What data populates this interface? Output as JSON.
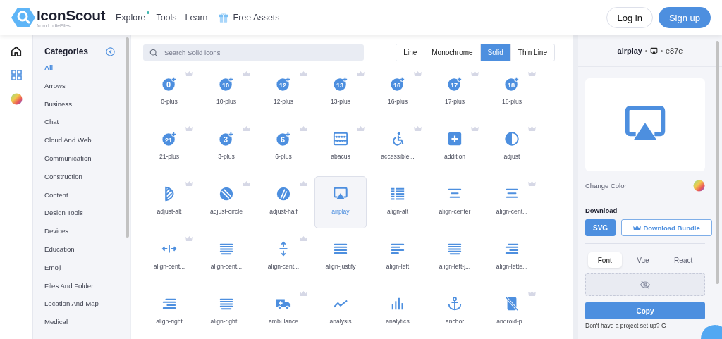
{
  "header": {
    "logo": {
      "name": "IconScout",
      "tagline": "from LottieFiles"
    },
    "nav": [
      {
        "label": "Explore",
        "dot": true
      },
      {
        "label": "Tools",
        "dot": false
      },
      {
        "label": "Learn",
        "dot": false
      },
      {
        "label": "Free Assets",
        "dot": false,
        "gift": true
      }
    ],
    "login": "Log in",
    "signup": "Sign up"
  },
  "rail": [
    {
      "kind": "home",
      "selected": false
    },
    {
      "kind": "grid",
      "selected": true
    },
    {
      "kind": "wheel",
      "selected": false
    }
  ],
  "categories": {
    "title": "Categories",
    "items": [
      {
        "label": "All",
        "selected": true
      },
      {
        "label": "Arrows",
        "selected": false
      },
      {
        "label": "Business",
        "selected": false
      },
      {
        "label": "Chat",
        "selected": false
      },
      {
        "label": "Cloud And Web",
        "selected": false
      },
      {
        "label": "Communication",
        "selected": false
      },
      {
        "label": "Construction",
        "selected": false
      },
      {
        "label": "Content",
        "selected": false
      },
      {
        "label": "Design Tools",
        "selected": false
      },
      {
        "label": "Devices",
        "selected": false
      },
      {
        "label": "Education",
        "selected": false
      },
      {
        "label": "Emoji",
        "selected": false
      },
      {
        "label": "Files And Folder",
        "selected": false
      },
      {
        "label": "Location And Map",
        "selected": false
      },
      {
        "label": "Medical",
        "selected": false
      }
    ]
  },
  "search": {
    "placeholder": "Search Solid icons"
  },
  "styles": [
    {
      "label": "Line",
      "selected": false
    },
    {
      "label": "Monochrome",
      "selected": false
    },
    {
      "label": "Solid",
      "selected": true
    },
    {
      "label": "Thin Line",
      "selected": false
    }
  ],
  "icons": [
    {
      "label": "0-plus",
      "kind": "num",
      "glyph": "0",
      "premium": true,
      "selected": false
    },
    {
      "label": "10-plus",
      "kind": "num",
      "glyph": "10",
      "premium": true,
      "selected": false
    },
    {
      "label": "12-plus",
      "kind": "num",
      "glyph": "12",
      "premium": true,
      "selected": false
    },
    {
      "label": "13-plus",
      "kind": "num",
      "glyph": "13",
      "premium": true,
      "selected": false
    },
    {
      "label": "16-plus",
      "kind": "num",
      "glyph": "16",
      "premium": true,
      "selected": false
    },
    {
      "label": "17-plus",
      "kind": "num",
      "glyph": "17",
      "premium": true,
      "selected": false
    },
    {
      "label": "18-plus",
      "kind": "num",
      "glyph": "18",
      "premium": true,
      "selected": false
    },
    {
      "label": "21-plus",
      "kind": "num",
      "glyph": "21",
      "premium": true,
      "selected": false
    },
    {
      "label": "3-plus",
      "kind": "num",
      "glyph": "3",
      "premium": true,
      "selected": false
    },
    {
      "label": "6-plus",
      "kind": "num",
      "glyph": "6",
      "premium": true,
      "selected": false
    },
    {
      "label": "abacus",
      "kind": "abacus",
      "premium": true,
      "selected": false
    },
    {
      "label": "accessible...",
      "kind": "wheelchair",
      "premium": true,
      "selected": false
    },
    {
      "label": "addition",
      "kind": "plus-square",
      "premium": true,
      "selected": false
    },
    {
      "label": "adjust",
      "kind": "half-circle",
      "premium": true,
      "selected": false
    },
    {
      "label": "adjust-alt",
      "kind": "striped-half",
      "premium": true,
      "selected": false
    },
    {
      "label": "adjust-circle",
      "kind": "striped-circle",
      "premium": true,
      "selected": false
    },
    {
      "label": "adjust-half",
      "kind": "slashed-circle",
      "premium": true,
      "selected": false
    },
    {
      "label": "airplay",
      "kind": "screen",
      "premium": false,
      "selected": true
    },
    {
      "label": "align-alt",
      "kind": "lines-alt",
      "premium": false,
      "selected": false
    },
    {
      "label": "align-center",
      "kind": "lines-center",
      "premium": false,
      "selected": false
    },
    {
      "label": "align-cent...",
      "kind": "lines-center3",
      "premium": true,
      "selected": false
    },
    {
      "label": "align-cent...",
      "kind": "arrows-h",
      "premium": true,
      "selected": false
    },
    {
      "label": "align-cent...",
      "kind": "lines-justify",
      "premium": false,
      "selected": false
    },
    {
      "label": "align-cent...",
      "kind": "arrows-v",
      "premium": true,
      "selected": false
    },
    {
      "label": "align-justify",
      "kind": "lines-justify4",
      "premium": false,
      "selected": false
    },
    {
      "label": "align-left",
      "kind": "lines-left",
      "premium": false,
      "selected": false
    },
    {
      "label": "align-left-j...",
      "kind": "lines-justify",
      "premium": false,
      "selected": false
    },
    {
      "label": "align-lette...",
      "kind": "lines-right",
      "premium": false,
      "selected": false
    },
    {
      "label": "align-right",
      "kind": "lines-right",
      "premium": false,
      "selected": false
    },
    {
      "label": "align-right...",
      "kind": "lines-justify",
      "premium": false,
      "selected": false
    },
    {
      "label": "ambulance",
      "kind": "ambulance",
      "premium": true,
      "selected": false
    },
    {
      "label": "analysis",
      "kind": "zigzag",
      "premium": false,
      "selected": false
    },
    {
      "label": "analytics",
      "kind": "bars",
      "premium": false,
      "selected": false
    },
    {
      "label": "anchor",
      "kind": "anchor",
      "premium": false,
      "selected": false
    },
    {
      "label": "android-p...",
      "kind": "phone-off",
      "premium": true,
      "selected": false
    }
  ],
  "detail": {
    "name": "airplay",
    "code": "e87e",
    "change_color": "Change Color",
    "download_title": "Download",
    "formats": [
      {
        "label": "SVG",
        "kind": "primary"
      },
      {
        "label": "Download Bundle",
        "kind": "bundle"
      }
    ],
    "tabs": [
      {
        "label": "Font",
        "selected": true
      },
      {
        "label": "Vue",
        "selected": false
      },
      {
        "label": "React",
        "selected": false
      }
    ],
    "copy": "Copy",
    "footer": "Don't have a project set up? G"
  }
}
